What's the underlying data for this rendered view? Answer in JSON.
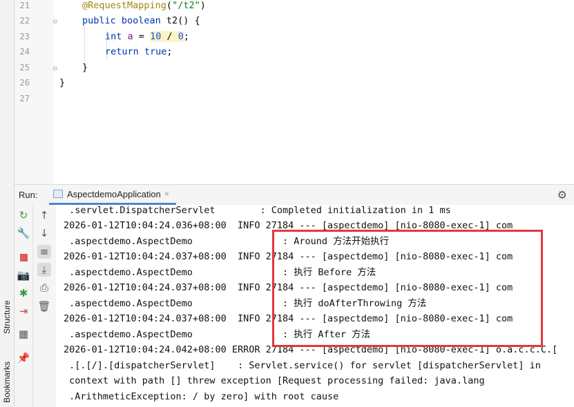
{
  "side_tabs": {
    "structure": "Structure",
    "bookmarks": "Bookmarks"
  },
  "editor": {
    "lines": [
      {
        "number": "21",
        "code": "@RequestMapping(\"/t2\")"
      },
      {
        "number": "22",
        "code": "public boolean t2() {"
      },
      {
        "number": "23",
        "code": "int a = 10 / 0;"
      },
      {
        "number": "24",
        "code": "return true;"
      },
      {
        "number": "25",
        "code": "}"
      },
      {
        "number": "26",
        "code": "}"
      },
      {
        "number": "27",
        "code": ""
      }
    ]
  },
  "run_panel": {
    "label": "Run:",
    "tab": {
      "label": "AspectdemoApplication",
      "close": "×"
    },
    "console_lines": [
      " .servlet.DispatcherServlet        : Completed initialization in 1 ms",
      "2026-01-12T10:04:24.036+08:00  INFO 27184 --- [aspectdemo] [nio-8080-exec-1] com",
      " .aspectdemo.AspectDemo                : Around 方法开始执行",
      "2026-01-12T10:04:24.037+08:00  INFO 27184 --- [aspectdemo] [nio-8080-exec-1] com",
      " .aspectdemo.AspectDemo                : 执行 Before 方法",
      "2026-01-12T10:04:24.037+08:00  INFO 27184 --- [aspectdemo] [nio-8080-exec-1] com",
      " .aspectdemo.AspectDemo                : 执行 doAfterThrowing 方法",
      "2026-01-12T10:04:24.037+08:00  INFO 27184 --- [aspectdemo] [nio-8080-exec-1] com",
      " .aspectdemo.AspectDemo                : 执行 After 方法",
      "2026-01-12T10:04:24.042+08:00 ERROR 27184 --- [aspectdemo] [nio-8080-exec-1] o.a.c.c.C.[",
      " .[.[/].[dispatcherServlet]    : Servlet.service() for servlet [dispatcherServlet] in",
      " context with path [] threw exception [Request processing failed: java.lang",
      " .ArithmeticException: / by zero] with root cause"
    ]
  },
  "icons": {
    "rerun": "rerun-icon",
    "wrench": "wrench-icon",
    "stop": "stop-icon",
    "camera": "camera-icon",
    "debug": "debug-icon",
    "exit": "exit-icon",
    "layout": "layout-icon",
    "pin": "pin-icon",
    "up": "arrow-up-icon",
    "down": "arrow-down-icon",
    "wrap": "soft-wrap-icon",
    "scroll": "scroll-to-end-icon",
    "print": "print-icon",
    "trash": "trash-icon",
    "gear": "gear-icon"
  },
  "colors": {
    "highlight_box": "#e0383d",
    "tab_underline": "#4a86c8",
    "keyword": "#0033b3",
    "annotation": "#9e880d"
  }
}
